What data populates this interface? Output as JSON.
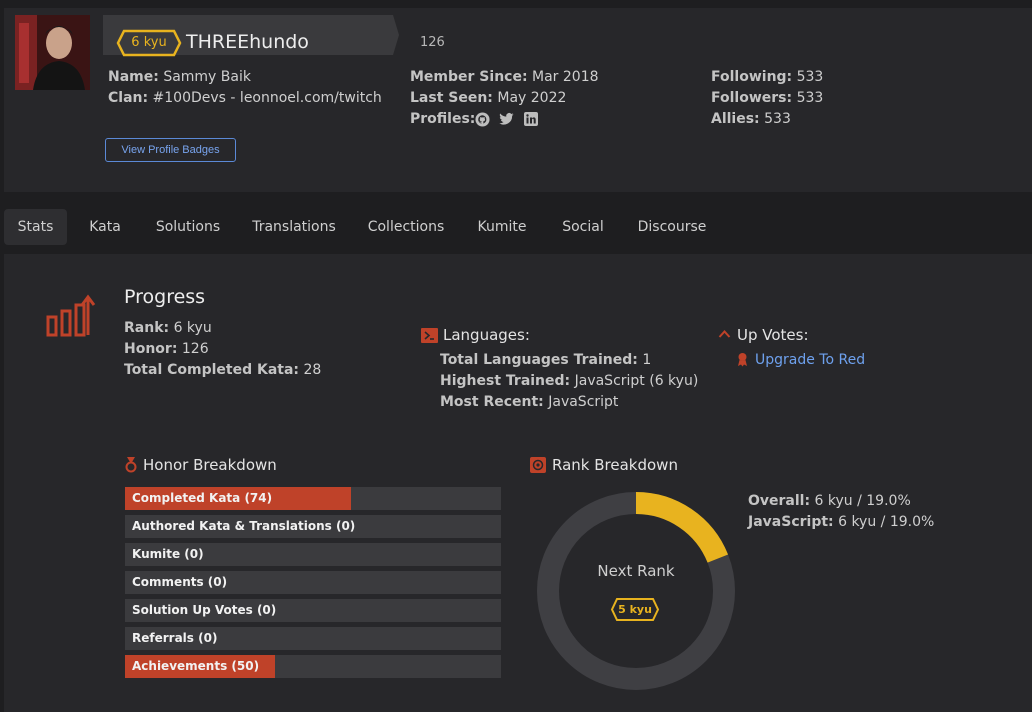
{
  "profile": {
    "rank": "6 kyu",
    "username": "THREEhundo",
    "honor": "126",
    "name_label": "Name:",
    "name": "Sammy Baik",
    "clan_label": "Clan:",
    "clan": "#100Devs - leonnoel.com/twitch",
    "member_since_label": "Member Since:",
    "member_since": "Mar 2018",
    "last_seen_label": "Last Seen:",
    "last_seen": "May 2022",
    "profiles_label": "Profiles:",
    "profile_icons": [
      "github-icon",
      "twitter-icon",
      "linkedin-icon"
    ],
    "following_label": "Following:",
    "following": "533",
    "followers_label": "Followers:",
    "followers": "533",
    "allies_label": "Allies:",
    "allies": "533",
    "badges_button": "View Profile Badges"
  },
  "tabs": [
    {
      "label": "Stats",
      "active": true
    },
    {
      "label": "Kata"
    },
    {
      "label": "Solutions"
    },
    {
      "label": "Translations"
    },
    {
      "label": "Collections"
    },
    {
      "label": "Kumite"
    },
    {
      "label": "Social"
    },
    {
      "label": "Discourse"
    }
  ],
  "progress": {
    "title": "Progress",
    "rank_label": "Rank:",
    "rank": "6 kyu",
    "honor_label": "Honor:",
    "honor": "126",
    "completed_label": "Total Completed Kata:",
    "completed": "28"
  },
  "languages": {
    "title": "Languages:",
    "total_label": "Total Languages Trained:",
    "total": "1",
    "highest_label": "Highest Trained:",
    "highest": "JavaScript (6 kyu)",
    "recent_label": "Most Recent:",
    "recent": "JavaScript"
  },
  "upvotes": {
    "title": "Up Votes:",
    "link": "Upgrade To Red"
  },
  "honor_breakdown": {
    "title": "Honor Breakdown",
    "items": [
      {
        "label": "Completed Kata (74)",
        "fill": 0.6
      },
      {
        "label": "Authored Kata & Translations (0)",
        "fill": 0
      },
      {
        "label": "Kumite (0)",
        "fill": 0
      },
      {
        "label": "Comments (0)",
        "fill": 0
      },
      {
        "label": "Solution Up Votes (0)",
        "fill": 0
      },
      {
        "label": "Referrals (0)",
        "fill": 0
      },
      {
        "label": "Achievements (50)",
        "fill": 0.4
      }
    ]
  },
  "rank_breakdown": {
    "title": "Rank Breakdown",
    "next_rank_label": "Next Rank",
    "next_rank": "5 kyu",
    "progress": 0.19,
    "overall_label": "Overall:",
    "overall": "6 kyu / 19.0%",
    "js_label": "JavaScript:",
    "js": "6 kyu / 19.0%"
  },
  "colors": {
    "accent": "#bf4229",
    "rank_yellow": "#e8b31f",
    "link": "#6ea1ee"
  }
}
